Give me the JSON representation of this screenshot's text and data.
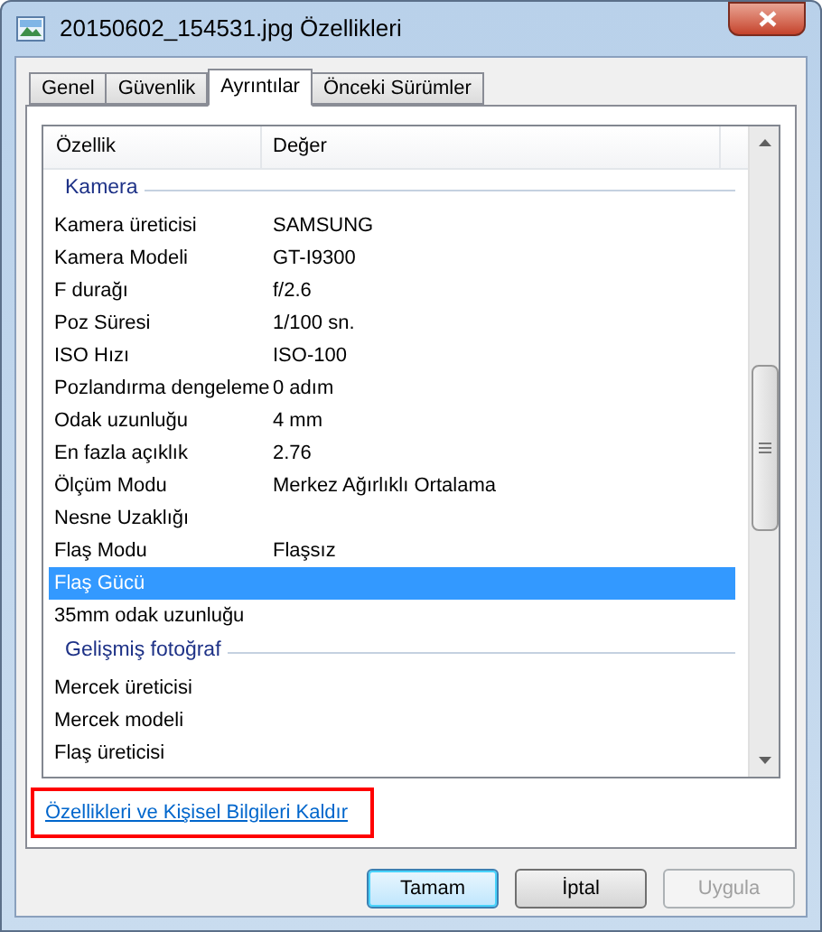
{
  "window": {
    "title": "20150602_154531.jpg Özellikleri"
  },
  "tabs": [
    {
      "label": "Genel",
      "selected": false
    },
    {
      "label": "Güvenlik",
      "selected": false
    },
    {
      "label": "Ayrıntılar",
      "selected": true
    },
    {
      "label": "Önceki Sürümler",
      "selected": false
    }
  ],
  "table": {
    "columns": [
      "Özellik",
      "Değer"
    ],
    "rows": [
      {
        "kind": "group",
        "name": "Kamera"
      },
      {
        "kind": "property",
        "name": "Kamera üreticisi",
        "value": "SAMSUNG",
        "selected": false
      },
      {
        "kind": "property",
        "name": "Kamera Modeli",
        "value": "GT-I9300",
        "selected": false
      },
      {
        "kind": "property",
        "name": "F durağı",
        "value": "f/2.6",
        "selected": false
      },
      {
        "kind": "property",
        "name": "Poz Süresi",
        "value": "1/100 sn.",
        "selected": false
      },
      {
        "kind": "property",
        "name": "ISO Hızı",
        "value": "ISO-100",
        "selected": false
      },
      {
        "kind": "property",
        "name": "Pozlandırma dengeleme",
        "value": "0 adım",
        "selected": false
      },
      {
        "kind": "property",
        "name": "Odak uzunluğu",
        "value": "4 mm",
        "selected": false
      },
      {
        "kind": "property",
        "name": "En fazla açıklık",
        "value": "2.76",
        "selected": false
      },
      {
        "kind": "property",
        "name": "Ölçüm Modu",
        "value": "Merkez Ağırlıklı Ortalama",
        "selected": false
      },
      {
        "kind": "property",
        "name": "Nesne Uzaklığı",
        "selected": false
      },
      {
        "kind": "property",
        "name": "Flaş Modu",
        "value": "Flaşsız",
        "selected": false
      },
      {
        "kind": "property",
        "name": "Flaş Gücü",
        "selected": true
      },
      {
        "kind": "property",
        "name": "35mm odak uzunluğu",
        "selected": false
      },
      {
        "kind": "group",
        "name": "Gelişmiş fotoğraf"
      },
      {
        "kind": "property",
        "name": "Mercek üreticisi",
        "selected": false
      },
      {
        "kind": "property",
        "name": "Mercek modeli",
        "selected": false
      },
      {
        "kind": "property",
        "name": "Flaş üreticisi",
        "selected": false
      }
    ]
  },
  "link": "Özellikleri ve Kişisel Bilgileri Kaldır",
  "buttons": [
    {
      "label": "Tamam",
      "default": true,
      "disabled": false
    },
    {
      "label": "İptal",
      "default": false,
      "disabled": false
    },
    {
      "label": "Uygula",
      "default": false,
      "disabled": true
    }
  ]
}
